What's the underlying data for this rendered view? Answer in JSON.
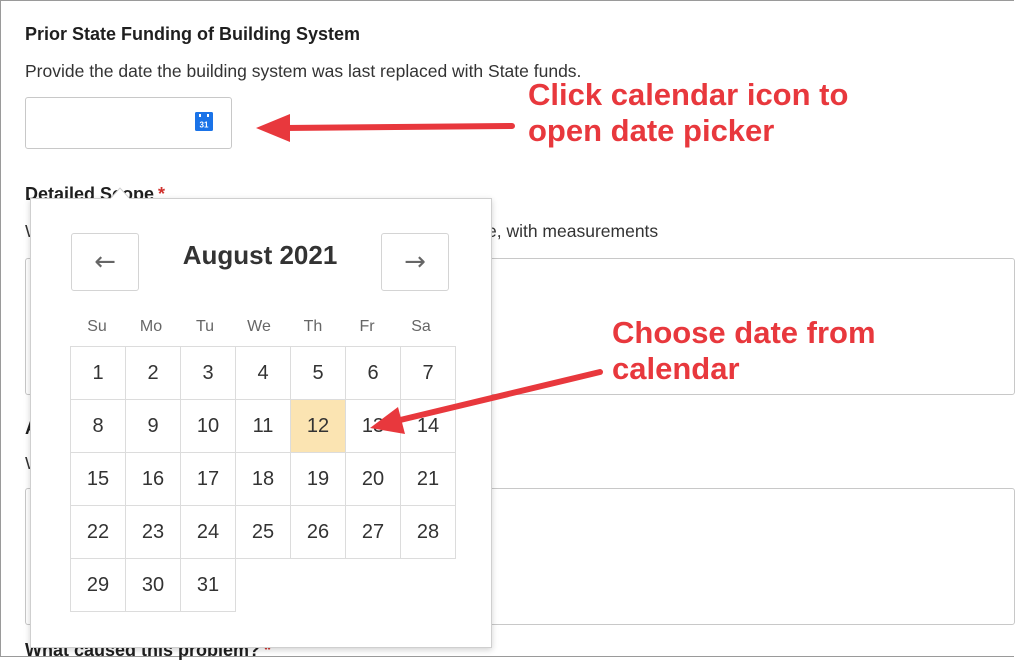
{
  "form": {
    "section_title": "Prior State Funding of Building System",
    "section_help": "Provide the date the building system was last replaced with State funds.",
    "date_value": "",
    "scope_label": "Detailed Scope",
    "required_mark": "*",
    "scope_help": "What work will be performed as part of this project? Describe, with measurements",
    "field3_label": "A",
    "field3_help": "W                                                          n?",
    "problem_label": "What caused this problem?"
  },
  "picker": {
    "month_label": "August 2021",
    "prev_icon": "arrow-left-icon",
    "next_icon": "arrow-right-icon",
    "weekdays": [
      "Su",
      "Mo",
      "Tu",
      "We",
      "Th",
      "Fr",
      "Sa"
    ],
    "weeks": [
      [
        "1",
        "2",
        "3",
        "4",
        "5",
        "6",
        "7"
      ],
      [
        "8",
        "9",
        "10",
        "11",
        "12",
        "13",
        "14"
      ],
      [
        "15",
        "16",
        "17",
        "18",
        "19",
        "20",
        "21"
      ],
      [
        "22",
        "23",
        "24",
        "25",
        "26",
        "27",
        "28"
      ],
      [
        "29",
        "30",
        "31",
        "",
        "",
        "",
        ""
      ]
    ],
    "highlighted_day": "12"
  },
  "icons": {
    "calendar_day": "31"
  },
  "annotations": {
    "callout1_line1": "Click calendar icon to",
    "callout1_line2": "open date picker",
    "callout2_line1": "Choose date from",
    "callout2_line2": "calendar",
    "color": "#e8383d"
  },
  "colors": {
    "highlight": "#fbe4b2",
    "required": "#d0312d",
    "calendar_icon": "#1a73e8"
  }
}
